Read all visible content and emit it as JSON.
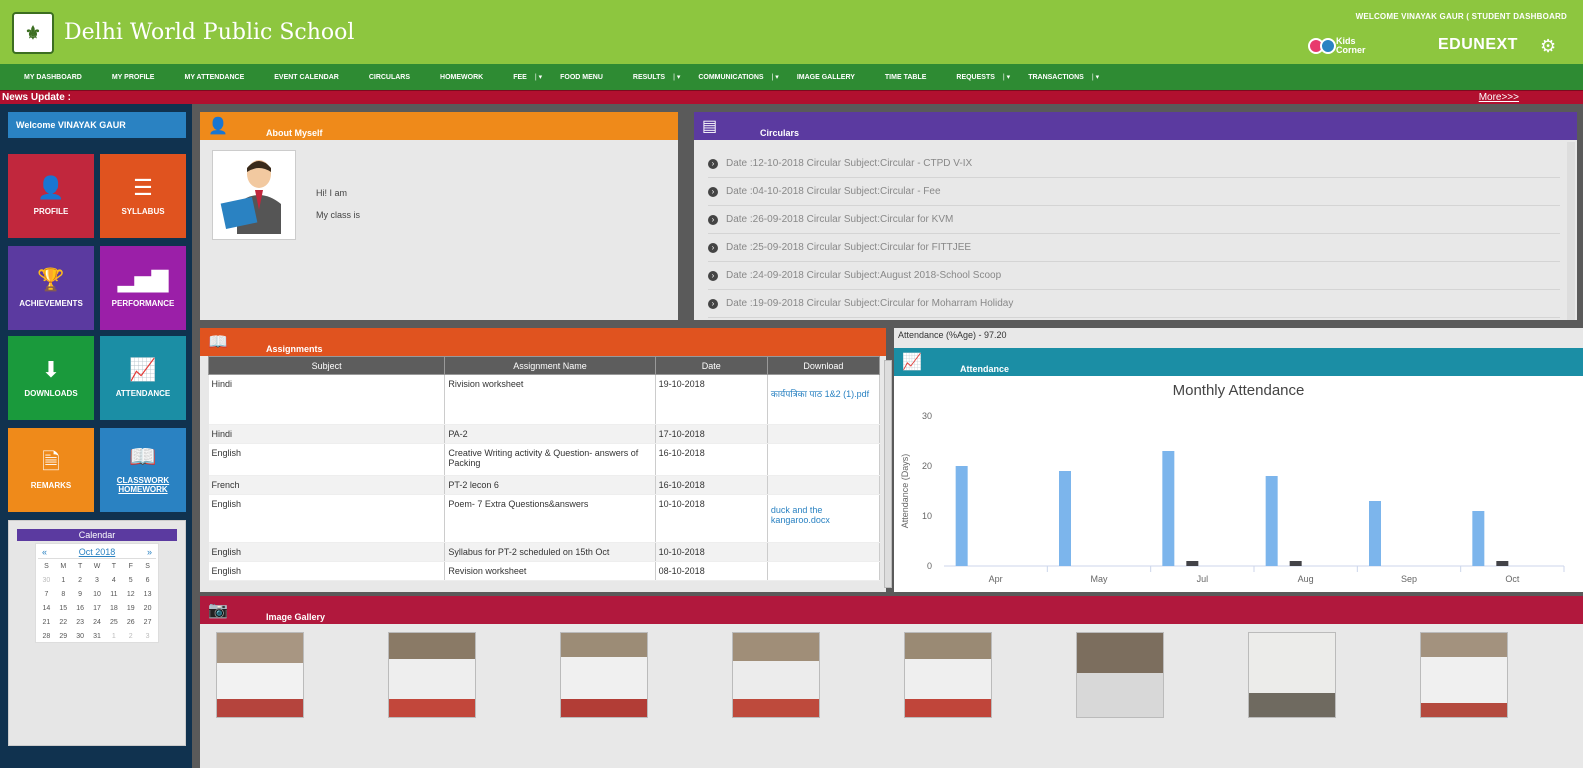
{
  "header": {
    "school_name": "Delhi World Public School",
    "welcome_text": "WELCOME VINAYAK GAUR ( STUDENT DASHBOARD",
    "kids_corner_top": "Kids",
    "kids_corner_bottom": "Corner",
    "brand": "EDUNEXT"
  },
  "navbar": {
    "items": [
      {
        "label": "My Dashboard"
      },
      {
        "label": "My Profile"
      },
      {
        "label": "My Attendance"
      },
      {
        "label": "Event Calendar"
      },
      {
        "label": "Circulars"
      },
      {
        "label": "Homework"
      },
      {
        "label": "Fee"
      },
      {
        "label": "Food Menu"
      },
      {
        "label": "Results"
      },
      {
        "label": "Communications"
      },
      {
        "label": "Image Gallery"
      },
      {
        "label": "Time Table"
      },
      {
        "label": "Requests"
      },
      {
        "label": "Transactions"
      }
    ]
  },
  "news": {
    "label": "News Update :",
    "more": "More>>>"
  },
  "sidebar": {
    "welcome": "Welcome VINAYAK GAUR",
    "tiles": [
      {
        "label": "PROFILE",
        "color": "#c1273d"
      },
      {
        "label": "SYLLABUS",
        "color": "#e0531f"
      },
      {
        "label": "ACHIEVEMENTS",
        "color": "#5b3aa0"
      },
      {
        "label": "PERFORMANCE",
        "color": "#9b1fa8"
      },
      {
        "label": "DOWNLOADS",
        "color": "#1a9a3c"
      },
      {
        "label": "ATTENDANCE",
        "color": "#1b8ea5"
      },
      {
        "label": "REMARKS",
        "color": "#ef8a1a"
      },
      {
        "label": "CLASSWORK HOMEWORK",
        "color": "#2a82c2"
      }
    ],
    "calendar": {
      "title": "Calendar",
      "month": "Oct 2018",
      "prev": "«",
      "next": "»",
      "weekdays": [
        "S",
        "M",
        "T",
        "W",
        "T",
        "F",
        "S"
      ],
      "rows": [
        [
          "30",
          "1",
          "2",
          "3",
          "4",
          "5",
          "6"
        ],
        [
          "7",
          "8",
          "9",
          "10",
          "11",
          "12",
          "13"
        ],
        [
          "14",
          "15",
          "16",
          "17",
          "18",
          "19",
          "20"
        ],
        [
          "21",
          "22",
          "23",
          "24",
          "25",
          "26",
          "27"
        ],
        [
          "28",
          "29",
          "30",
          "31",
          "1",
          "2",
          "3"
        ]
      ]
    }
  },
  "about": {
    "title": "About Myself",
    "line1": "Hi! I am",
    "line2": "My class is",
    "color": "#ef8a1a"
  },
  "circulars": {
    "title": "Circulars",
    "color": "#5b3aa0",
    "items": [
      {
        "text": "Date :12-10-2018    Circular Subject:Circular - CTPD V-IX"
      },
      {
        "text": "Date :04-10-2018    Circular Subject:Circular - Fee"
      },
      {
        "text": "Date :26-09-2018    Circular Subject:Circular for KVM"
      },
      {
        "text": "Date :25-09-2018    Circular Subject:Circular for FITTJEE"
      },
      {
        "text": "Date :24-09-2018    Circular Subject:August 2018-School Scoop"
      },
      {
        "text": "Date :19-09-2018    Circular Subject:Circular for Moharram Holiday"
      }
    ]
  },
  "assignments": {
    "title": "Assignments",
    "color": "#e0531f",
    "columns": [
      "Subject",
      "Assignment Name",
      "Date",
      "Download"
    ],
    "rows": [
      {
        "subject": "Hindi",
        "name": "Rivision worksheet",
        "date": "19-10-2018",
        "download": "कार्यपत्रिका पाठ 1&2 (1).pdf"
      },
      {
        "subject": "Hindi",
        "name": "PA-2",
        "date": "17-10-2018",
        "download": ""
      },
      {
        "subject": "English",
        "name": "Creative Writing activity & Question- answers of Packing",
        "date": "16-10-2018",
        "download": ""
      },
      {
        "subject": "French",
        "name": "PT-2 lecon 6",
        "date": "16-10-2018",
        "download": ""
      },
      {
        "subject": "English",
        "name": "Poem- 7 Extra Questions&answers",
        "date": "10-10-2018",
        "download": "duck and the kangaroo.docx"
      },
      {
        "subject": "English",
        "name": "Syllabus for PT-2 scheduled on 15th Oct",
        "date": "10-10-2018",
        "download": ""
      },
      {
        "subject": "English",
        "name": "Revision worksheet",
        "date": "08-10-2018",
        "download": ""
      }
    ]
  },
  "attendance": {
    "summary": "Attendance (%Age) - 97.20",
    "title": "Attendance",
    "color": "#1b8ea5"
  },
  "chart_data": {
    "type": "bar",
    "title": "Monthly Attendance",
    "ylabel": "Attendance (Days)",
    "xlabel": "",
    "categories": [
      "Apr",
      "May",
      "Jul",
      "Aug",
      "Sep",
      "Oct"
    ],
    "series": [
      {
        "values": [
          20,
          19,
          23,
          18,
          13,
          11
        ],
        "color": "#7cb5ec"
      },
      {
        "values": [
          0,
          0,
          1,
          1,
          0,
          1
        ],
        "color": "#434348"
      }
    ],
    "ylim": [
      0,
      30
    ],
    "yticks": [
      0,
      10,
      20,
      30
    ],
    "grid": false
  },
  "gallery": {
    "title": "Image Gallery",
    "color": "#b1183d"
  }
}
